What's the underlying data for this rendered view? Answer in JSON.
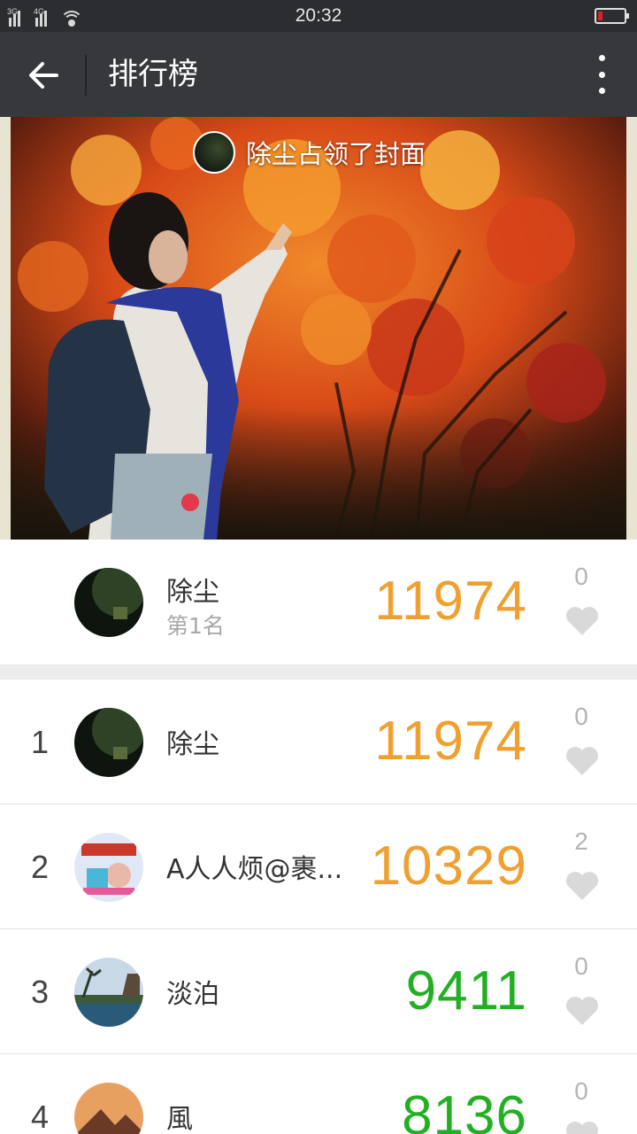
{
  "status_bar": {
    "signal1_label": "3G",
    "signal2_label": "4G",
    "time": "20:32"
  },
  "title_bar": {
    "title": "排行榜",
    "back_icon": "arrow-left-icon",
    "more_icon": "more-vertical-icon"
  },
  "cover": {
    "caption": "除尘占领了封面"
  },
  "winner": {
    "name": "除尘",
    "subtitle": "第1名",
    "score": "11974",
    "likes": "0"
  },
  "ranking": [
    {
      "rank": "1",
      "name": "除尘",
      "score": "11974",
      "likes": "0"
    },
    {
      "rank": "2",
      "name": "A人人烦@裹...",
      "score": "10329",
      "likes": "2"
    },
    {
      "rank": "3",
      "name": "淡泊",
      "score": "9411",
      "likes": "0"
    },
    {
      "rank": "4",
      "name": "風",
      "score": "8136",
      "likes": "0"
    }
  ],
  "colors": {
    "score_high": "#f0a030",
    "score_low": "#22b022",
    "heart": "#d9d9d9",
    "title_bar": "#37383b"
  }
}
